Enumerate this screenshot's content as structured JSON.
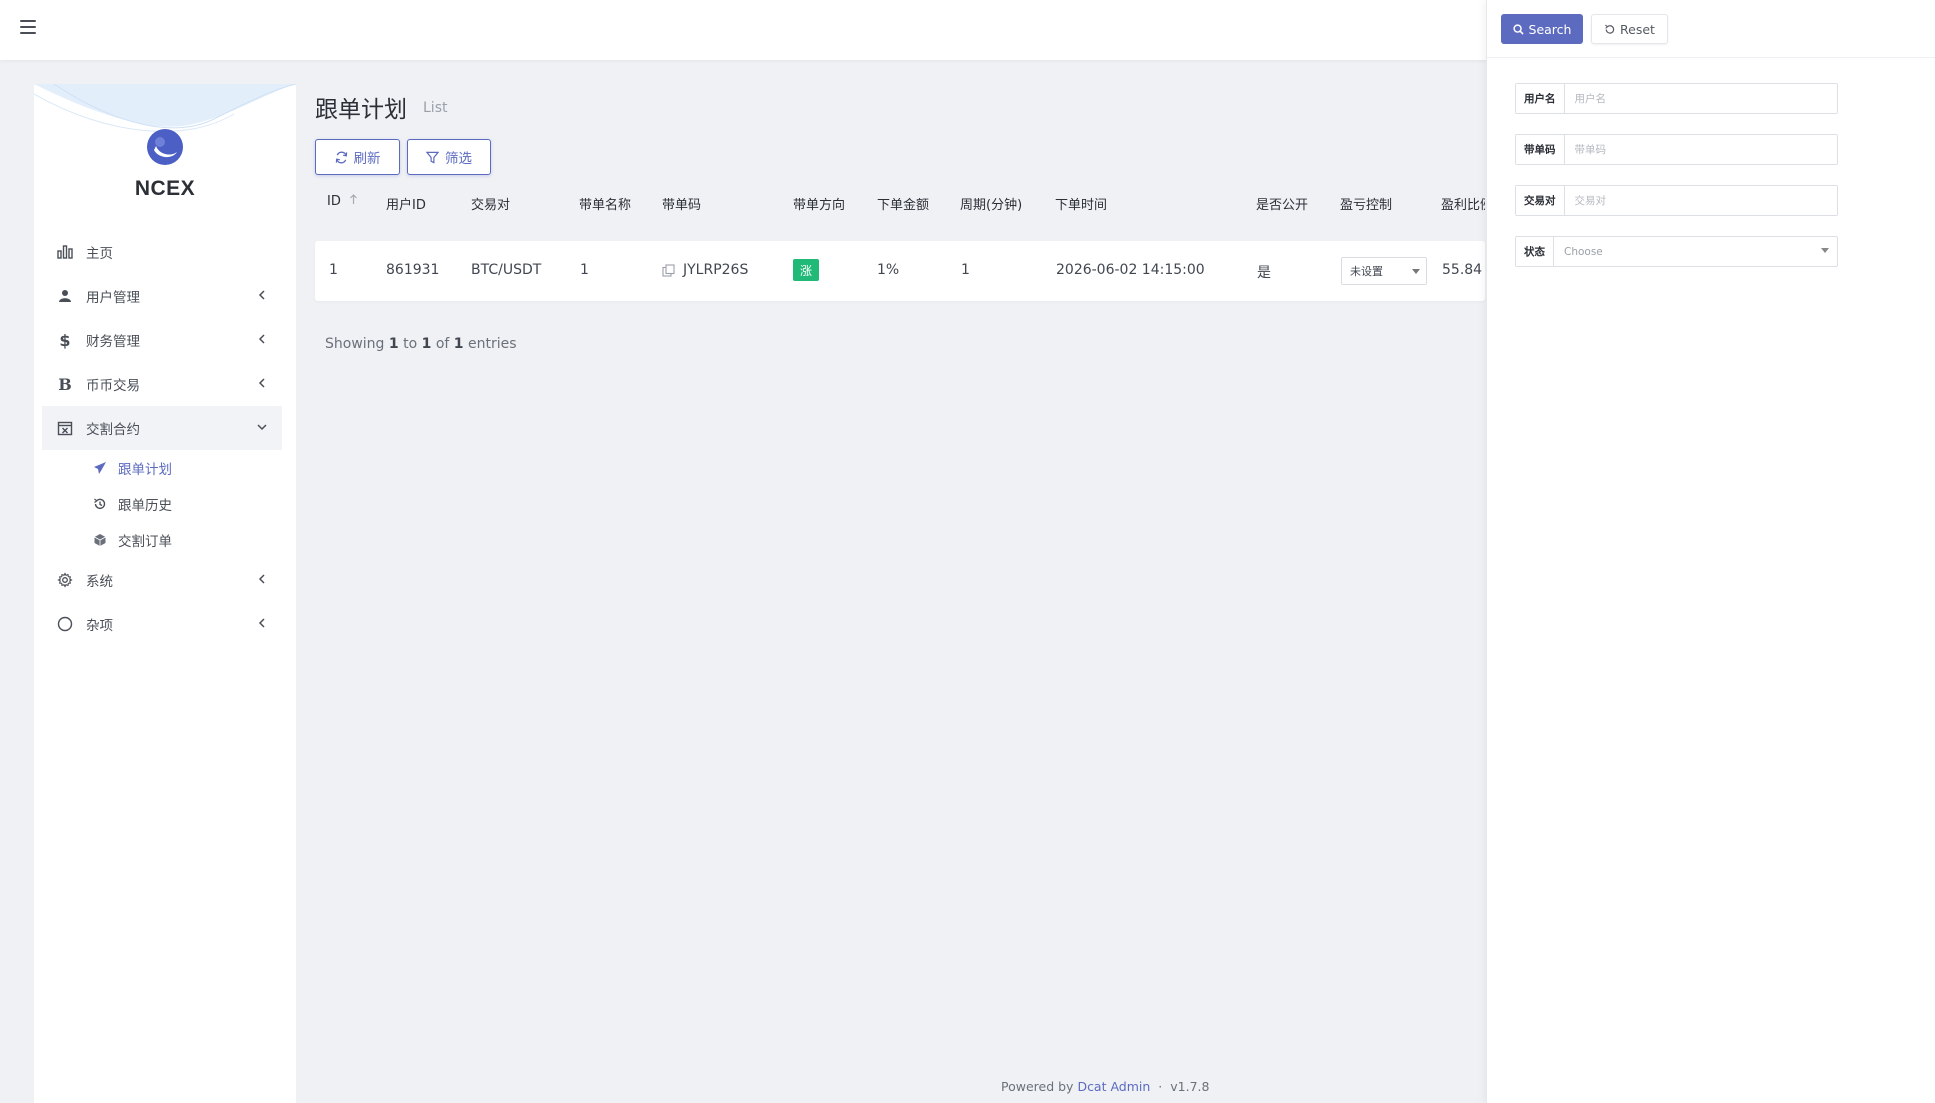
{
  "brand": {
    "name": "NCEX"
  },
  "sidebar": {
    "items": [
      {
        "label": "主页",
        "icon": "bar-chart-icon"
      },
      {
        "label": "用户管理",
        "icon": "users-icon"
      },
      {
        "label": "财务管理",
        "icon": "dollar-icon"
      },
      {
        "label": "币币交易",
        "icon": "bitcoin-icon"
      },
      {
        "label": "交割合约",
        "icon": "calendar-x-icon"
      },
      {
        "label": "系统",
        "icon": "gear-icon"
      },
      {
        "label": "杂项",
        "icon": "circle-icon"
      }
    ],
    "subitems": [
      {
        "label": "跟单计划",
        "icon": "plane-icon"
      },
      {
        "label": "跟单历史",
        "icon": "history-icon"
      },
      {
        "label": "交割订单",
        "icon": "cube-icon"
      }
    ]
  },
  "page": {
    "title": "跟单计划",
    "subtitle": "List",
    "refresh_label": "刷新",
    "filter_label": "筛选"
  },
  "table": {
    "headers": [
      "ID",
      "用户ID",
      "交易对",
      "带单名称",
      "带单码",
      "带单方向",
      "下单金额",
      "周期(分钟)",
      "下单时间",
      "是否公开",
      "盈亏控制",
      "盈利比例"
    ],
    "rows": [
      {
        "id": "1",
        "user_id": "861931",
        "pair": "BTC/USDT",
        "name": "1",
        "code": "JYLRP26S",
        "direction": "涨",
        "amount": "1%",
        "period": "1",
        "time": "2026-06-02 14:15:00",
        "public": "是",
        "pnl_control": "未设置",
        "profit_ratio": "55.84"
      }
    ]
  },
  "pagination": {
    "showing": "Showing",
    "from": "1",
    "to_word": "to",
    "to": "1",
    "of_word": "of",
    "total": "1",
    "entries": "entries"
  },
  "footer": {
    "powered": "Powered by",
    "link": "Dcat Admin",
    "sep": "·",
    "version": "v1.7.8"
  },
  "filter_panel": {
    "search_label": "Search",
    "reset_label": "Reset",
    "fields": [
      {
        "label": "用户名",
        "placeholder": "用户名"
      },
      {
        "label": "带单码",
        "placeholder": "带单码"
      },
      {
        "label": "交易对",
        "placeholder": "交易对"
      }
    ],
    "status": {
      "label": "状态",
      "placeholder": "Choose"
    }
  },
  "colors": {
    "primary": "#5c6bc0",
    "success": "#21b978",
    "background": "#eff1f5"
  }
}
